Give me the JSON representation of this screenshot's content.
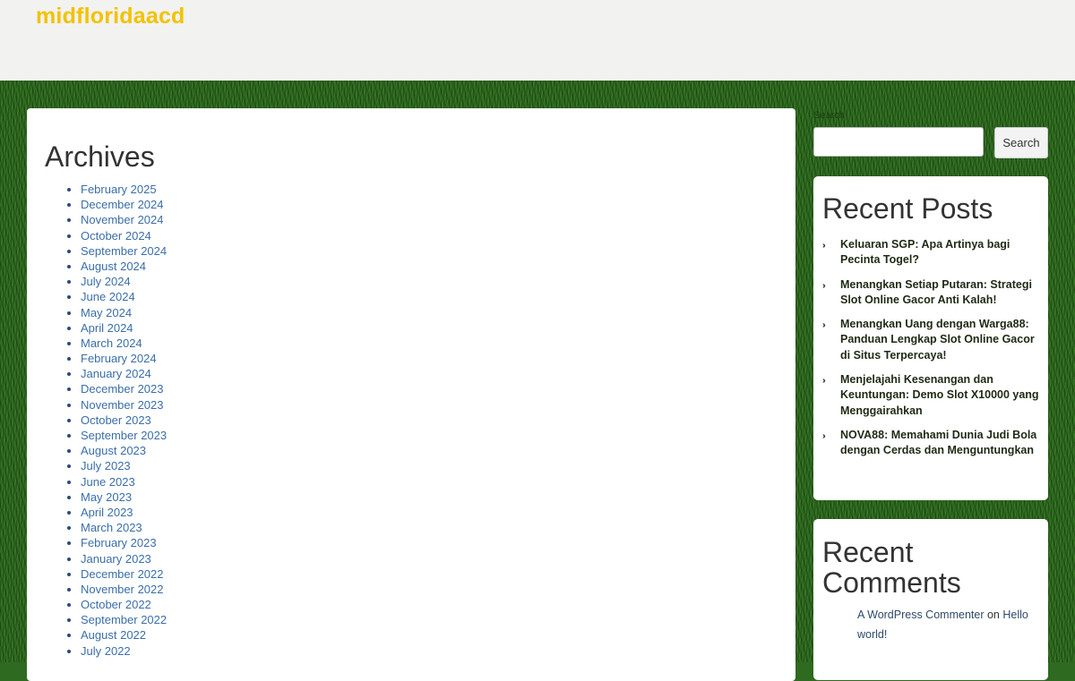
{
  "site": {
    "title": "midfloridaacd"
  },
  "archives": {
    "title": "Archives",
    "items": [
      "February 2025",
      "December 2024",
      "November 2024",
      "October 2024",
      "September 2024",
      "August 2024",
      "July 2024",
      "June 2024",
      "May 2024",
      "April 2024",
      "March 2024",
      "February 2024",
      "January 2024",
      "December 2023",
      "November 2023",
      "October 2023",
      "September 2023",
      "August 2023",
      "July 2023",
      "June 2023",
      "May 2023",
      "April 2023",
      "March 2023",
      "February 2023",
      "January 2023",
      "December 2022",
      "November 2022",
      "October 2022",
      "September 2022",
      "August 2022",
      "July 2022"
    ]
  },
  "search": {
    "label": "Search",
    "button": "Search",
    "placeholder": ""
  },
  "recent_posts": {
    "title": "Recent Posts",
    "items": [
      "Keluaran SGP: Apa Artinya bagi Pecinta Togel?",
      "Menangkan Setiap Putaran: Strategi Slot Online Gacor Anti Kalah!",
      "Menangkan Uang dengan Warga88: Panduan Lengkap Slot Online Gacor di Situs Terpercaya!",
      "Menjelajahi Kesenangan dan Keuntungan: Demo Slot X10000 yang Menggairahkan",
      "NOVA88: Memahami Dunia Judi Bola dengan Cerdas dan Menguntungkan"
    ]
  },
  "recent_comments": {
    "title": "Recent Comments",
    "author": "A WordPress Commenter",
    "on": "on",
    "post": "Hello world!"
  },
  "colors": {
    "title": "#f2c200",
    "link": "#3b6ea8",
    "grass": "#2f6b20"
  },
  "icons": {
    "post_bullet": "double-chevron-right-icon"
  }
}
